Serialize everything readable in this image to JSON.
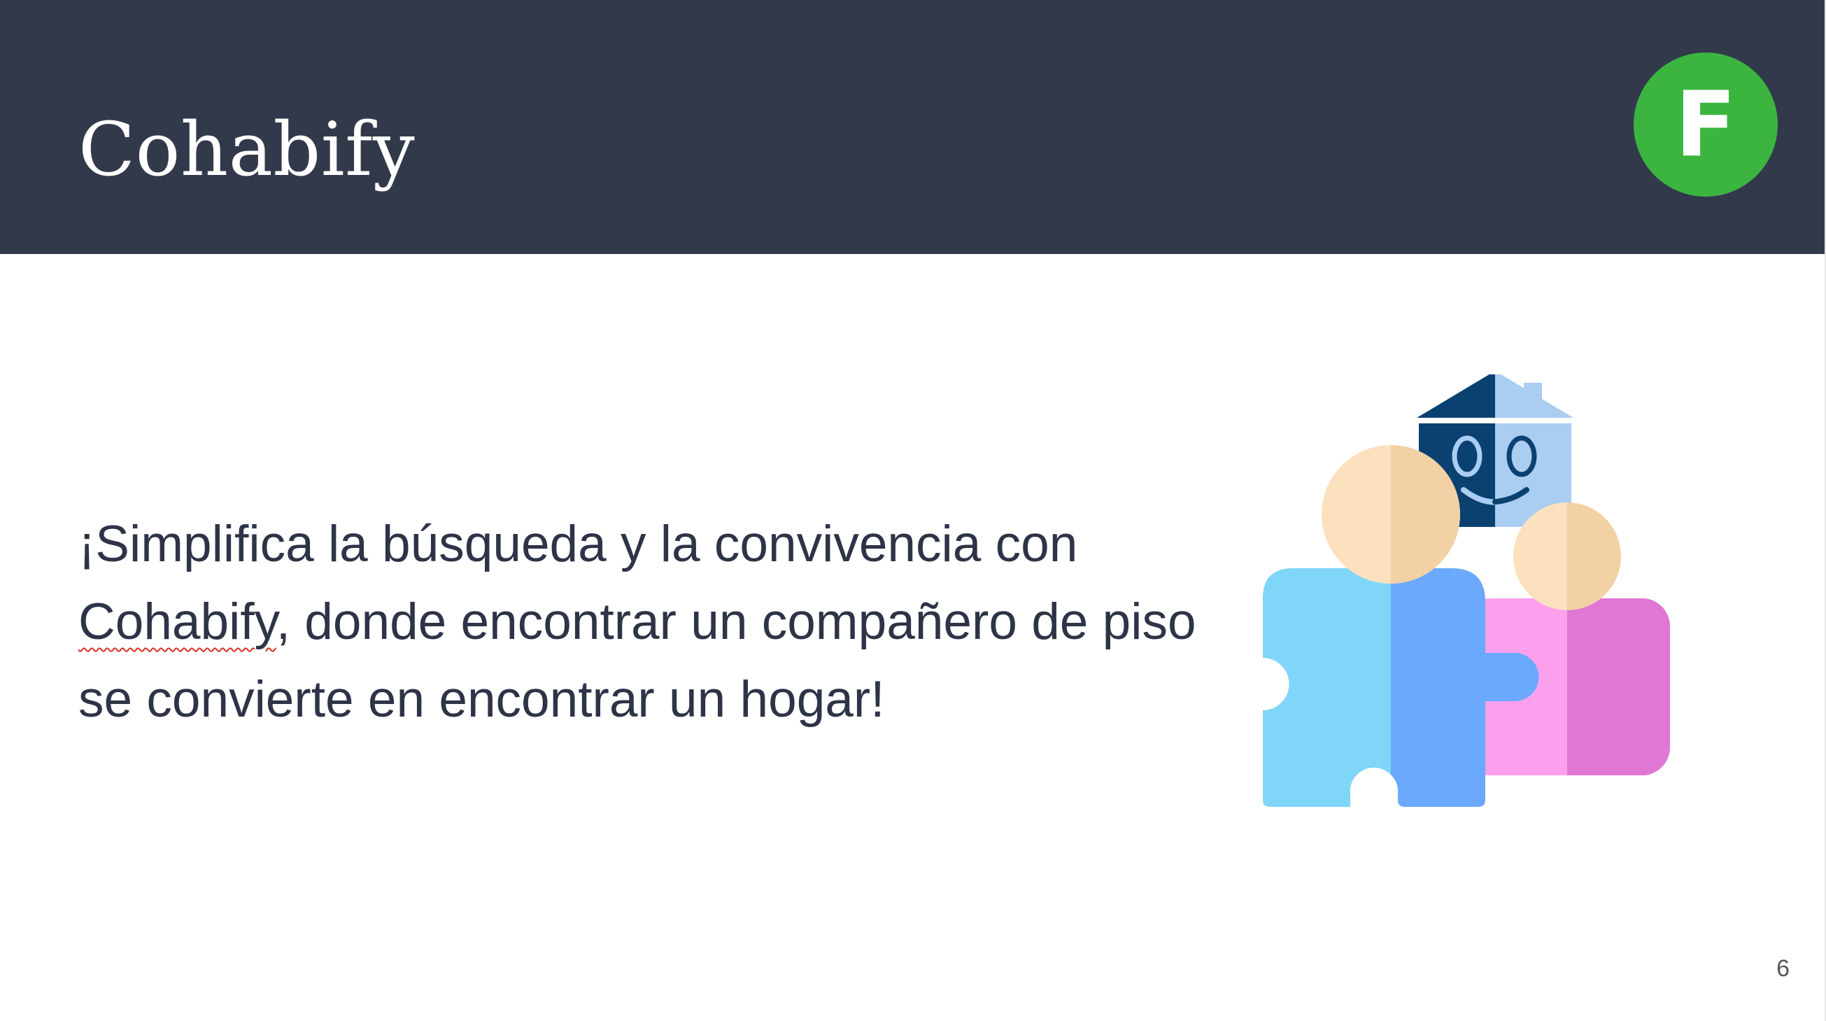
{
  "slide": {
    "title": "Cohabify",
    "logo_letter": "F",
    "body_parts": {
      "before": "¡Simplifica la búsqueda y la convivencia con ",
      "flagged_word": "Cohabify",
      "after": ", donde encontrar un compañero de piso se convierte en encontrar un hogar!"
    },
    "page_number": "6"
  },
  "colors": {
    "header_bg": "#32394b",
    "logo_bg": "#3bb540",
    "body_text": "#2e3447",
    "puzzle_light_blue": "#7fd6f8",
    "puzzle_blue": "#6aa9fb",
    "puzzle_pink_light": "#fca0ee",
    "puzzle_pink": "#e177d4",
    "head_light": "#fce1be",
    "head_shade": "#f2d1a4",
    "house_dark": "#0b4170",
    "house_light": "#aacdf2"
  },
  "illustration": {
    "icon": "roommates-puzzle-house-icon"
  }
}
